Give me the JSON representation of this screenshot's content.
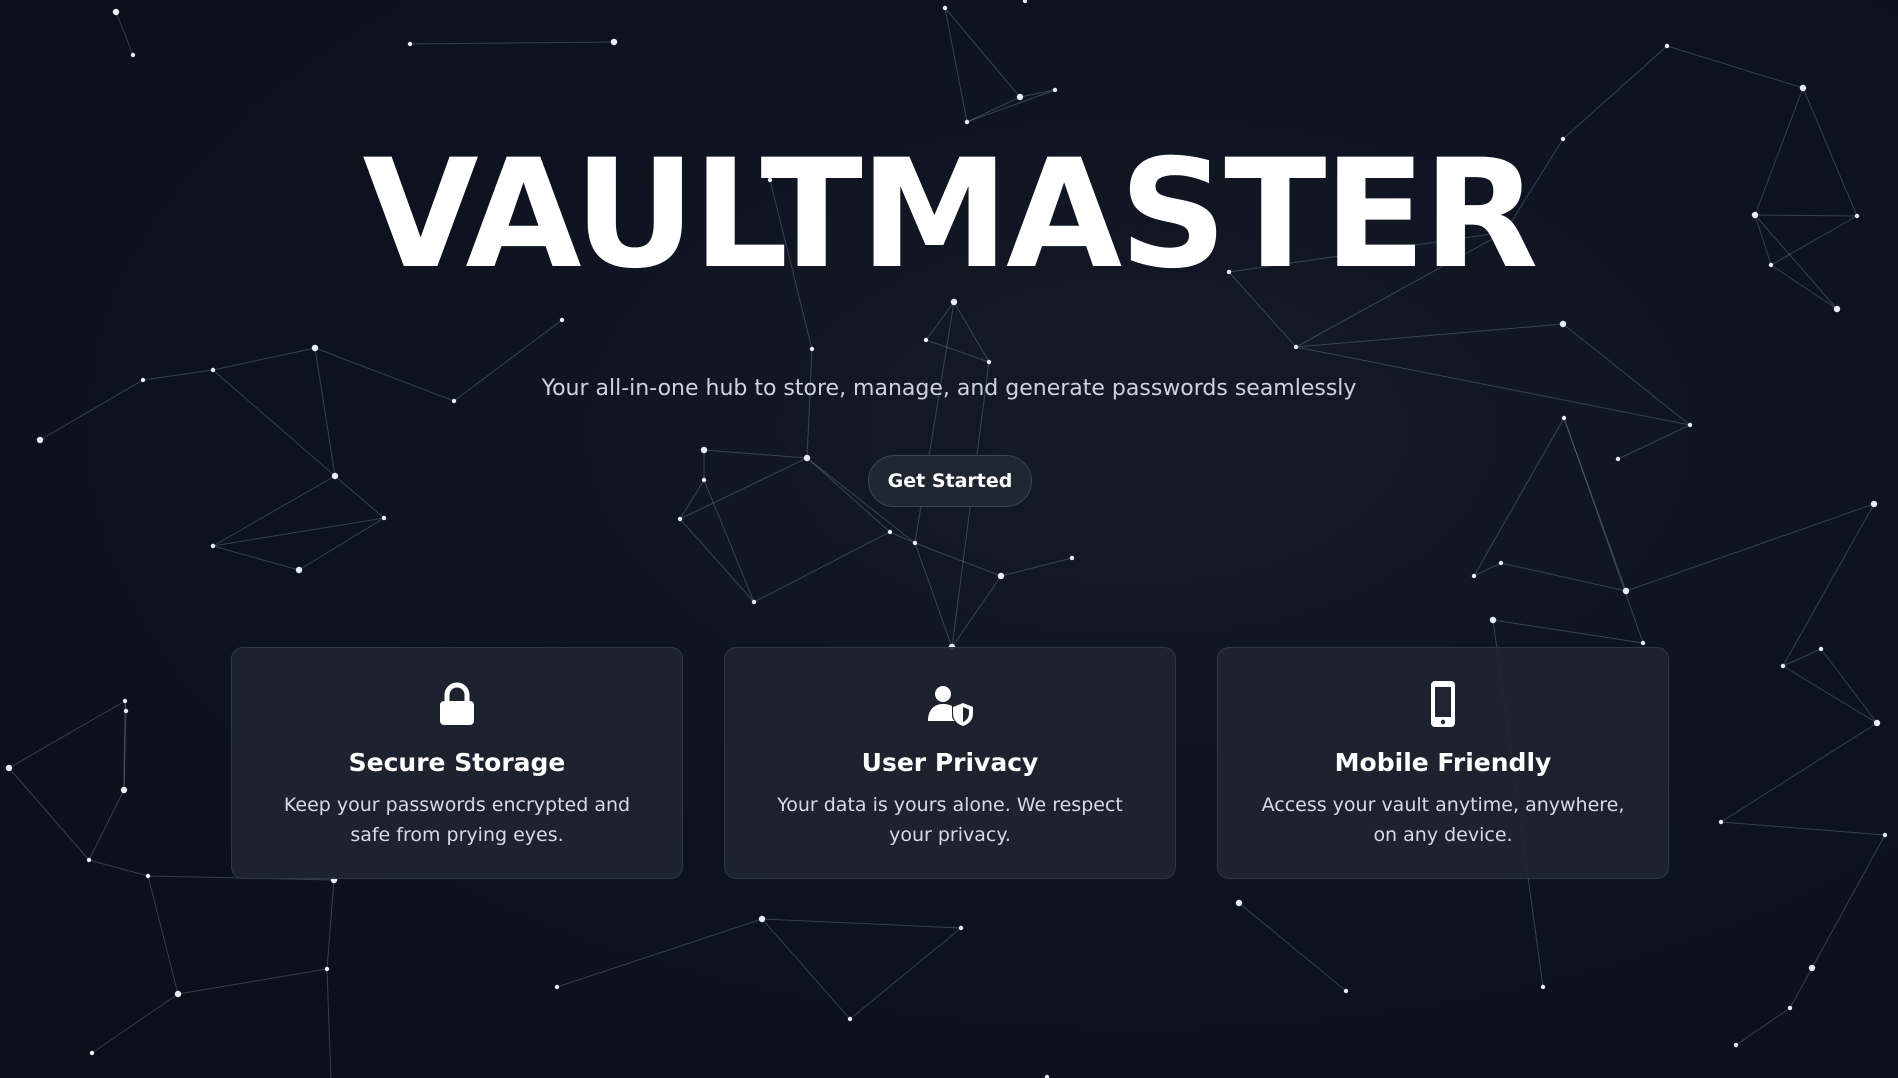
{
  "hero": {
    "title": "VAULTMASTER",
    "subtitle": "Your all-in-one hub to store, manage, and generate passwords seamlessly",
    "cta_label": "Get Started"
  },
  "features": [
    {
      "icon": "lock-icon",
      "title": "Secure Storage",
      "description": "Keep your passwords encrypted and safe from prying eyes."
    },
    {
      "icon": "user-shield-icon",
      "title": "User Privacy",
      "description": "Your data is yours alone. We respect your privacy."
    },
    {
      "icon": "mobile-phone-icon",
      "title": "Mobile Friendly",
      "description": "Access your vault anytime, anywhere, on any device."
    }
  ],
  "colors": {
    "background": "#0b101b",
    "card": "#1e2430",
    "accent_text": "#ffffff",
    "muted_text": "#cdd3de"
  }
}
